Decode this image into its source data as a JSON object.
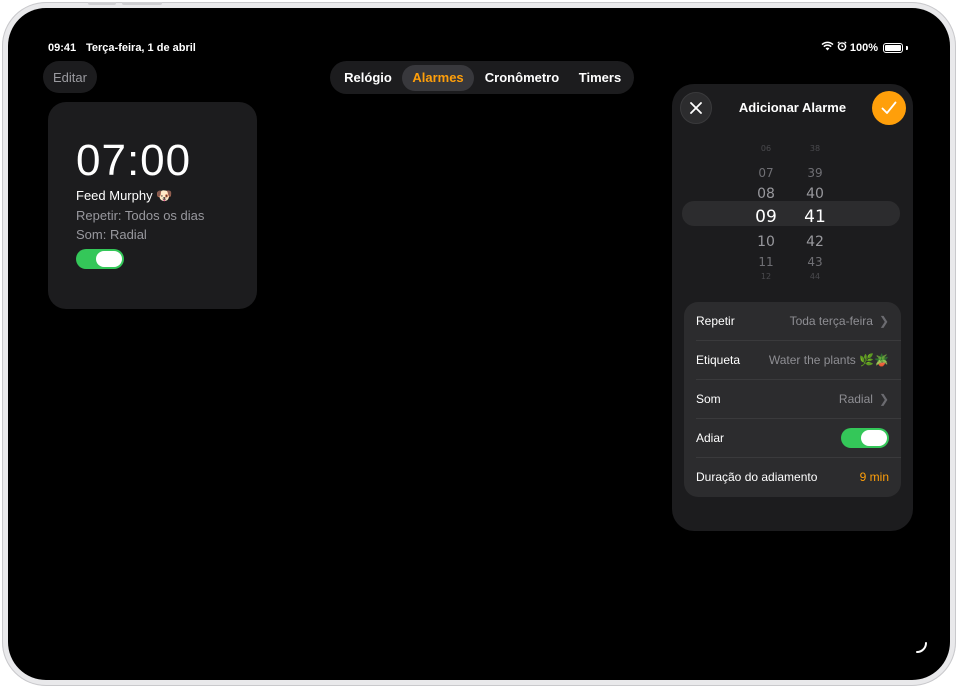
{
  "status": {
    "time": "09:41",
    "date": "Terça-feira, 1 de abril",
    "battery": "100%"
  },
  "toolbar": {
    "edit_label": "Editar"
  },
  "tabs": [
    {
      "label": "Relógio",
      "active": false
    },
    {
      "label": "Alarmes",
      "active": true
    },
    {
      "label": "Cronômetro",
      "active": false
    },
    {
      "label": "Timers",
      "active": false
    }
  ],
  "alarm": {
    "time": "07:00",
    "label": "Feed Murphy 🐶",
    "repeat": "Repetir: Todos os dias",
    "sound": "Som: Radial",
    "enabled": true
  },
  "add_alarm": {
    "title": "Adicionar Alarme",
    "hours": [
      "06",
      "07",
      "08",
      "09",
      "10",
      "11",
      "12"
    ],
    "minutes": [
      "38",
      "39",
      "40",
      "41",
      "42",
      "43",
      "44"
    ],
    "selected_hour": "09",
    "selected_minute": "41",
    "repeat_label": "Repetir",
    "repeat_value": "Toda terça-feira",
    "label_label": "Etiqueta",
    "label_value": "Water the plants 🌿🪴",
    "sound_label": "Som",
    "sound_value": "Radial",
    "snooze_label": "Adiar",
    "snooze_enabled": true,
    "snooze_duration_label": "Duração do adiamento",
    "snooze_duration_value": "9 min"
  },
  "colors": {
    "accent": "#ff9f0a",
    "toggle_on": "#34c759",
    "card": "#1c1c1e"
  }
}
